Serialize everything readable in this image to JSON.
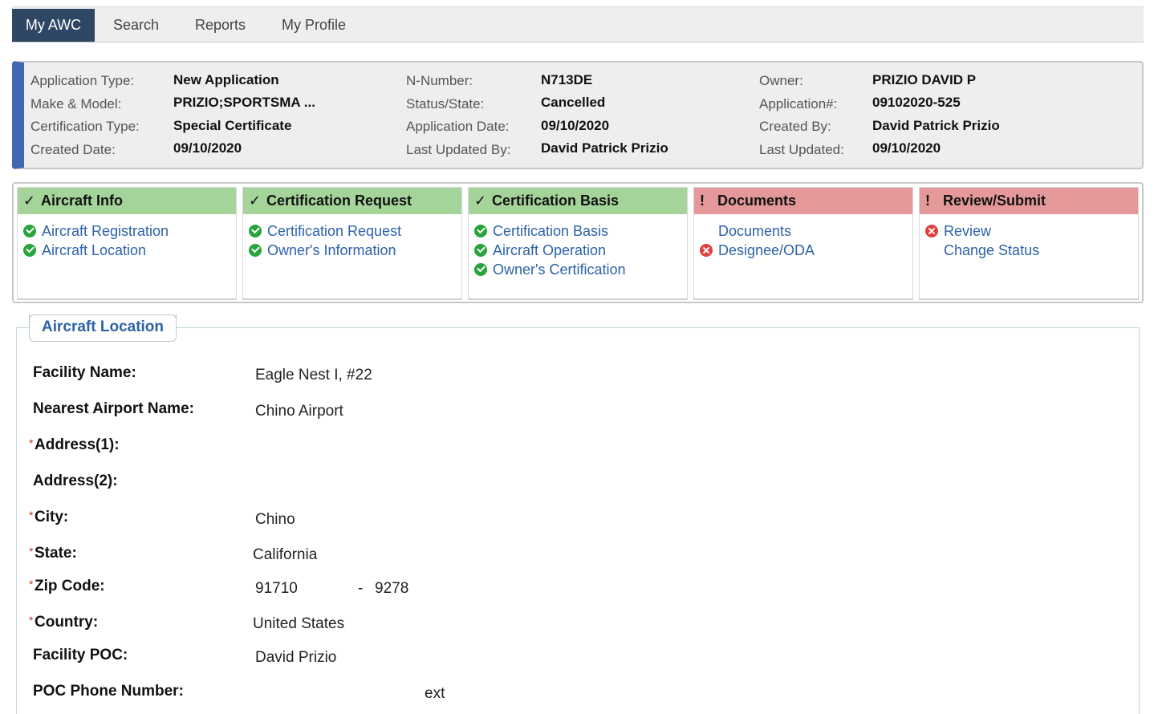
{
  "nav": {
    "tabs": [
      "My AWC",
      "Search",
      "Reports",
      "My Profile"
    ]
  },
  "summary": {
    "col1": [
      {
        "label": "Application Type:",
        "value": "New Application"
      },
      {
        "label": "Make & Model:",
        "value": "PRIZIO;SPORTSMA ..."
      },
      {
        "label": "Certification Type:",
        "value": "Special Certificate"
      },
      {
        "label": "Created Date:",
        "value": "09/10/2020"
      }
    ],
    "col2": [
      {
        "label": "N-Number:",
        "value": "N713DE"
      },
      {
        "label": "Status/State:",
        "value": "Cancelled"
      },
      {
        "label": "Application Date:",
        "value": "09/10/2020"
      },
      {
        "label": "Last Updated By:",
        "value": "David Patrick Prizio"
      }
    ],
    "col3": [
      {
        "label": "Owner:",
        "value": "PRIZIO DAVID P"
      },
      {
        "label": "Application#:",
        "value": "09102020-525"
      },
      {
        "label": "Created By:",
        "value": "David Patrick Prizio"
      },
      {
        "label": "Last Updated:",
        "value": "09/10/2020"
      }
    ]
  },
  "steps": [
    {
      "title": "Aircraft Info",
      "status": "complete",
      "mark": "✓",
      "items": [
        {
          "label": "Aircraft Registration",
          "status": "complete"
        },
        {
          "label": "Aircraft Location",
          "status": "complete"
        }
      ]
    },
    {
      "title": "Certification Request",
      "status": "complete",
      "mark": "✓",
      "items": [
        {
          "label": "Certification Request",
          "status": "complete"
        },
        {
          "label": "Owner's Information",
          "status": "complete"
        }
      ]
    },
    {
      "title": "Certification Basis",
      "status": "complete",
      "mark": "✓",
      "items": [
        {
          "label": "Certification Basis",
          "status": "complete"
        },
        {
          "label": "Aircraft Operation",
          "status": "complete"
        },
        {
          "label": "Owner's Certification",
          "status": "complete"
        }
      ]
    },
    {
      "title": "Documents",
      "status": "incomplete",
      "mark": "!",
      "items": [
        {
          "label": "Documents",
          "status": "none"
        },
        {
          "label": "Designee/ODA",
          "status": "error"
        }
      ]
    },
    {
      "title": "Review/Submit",
      "status": "incomplete",
      "mark": "!",
      "items": [
        {
          "label": "Review",
          "status": "error"
        },
        {
          "label": "Change Status",
          "status": "none"
        }
      ]
    }
  ],
  "location": {
    "legend": "Aircraft Location",
    "fields": {
      "facility_name": {
        "label": "Facility Name:",
        "value": "Eagle Nest I, #22"
      },
      "nearest_airport": {
        "label": "Nearest Airport Name:",
        "value": "Chino Airport"
      },
      "address1": {
        "label": "Address(1):",
        "value": "",
        "required": "*"
      },
      "address2": {
        "label": "Address(2):",
        "value": ""
      },
      "city": {
        "label": "City:",
        "value": "Chino",
        "required": "*"
      },
      "state": {
        "label": "State:",
        "value": "California",
        "required": "*"
      },
      "zip": {
        "label": "Zip Code:",
        "value": "91710",
        "separator": "-",
        "ext": "9278",
        "required": "*"
      },
      "country": {
        "label": "Country:",
        "value": "United States",
        "required": "*"
      },
      "facility_poc": {
        "label": "Facility POC:",
        "value": "David Prizio"
      },
      "poc_phone": {
        "label": "POC Phone Number:",
        "value": "",
        "ext_label": "ext"
      }
    }
  },
  "colors": {
    "nav_active": "#2e4765",
    "accent": "#3f67b3",
    "complete": "#a5d49a",
    "incomplete": "#e59899",
    "link": "#2d62a8"
  }
}
